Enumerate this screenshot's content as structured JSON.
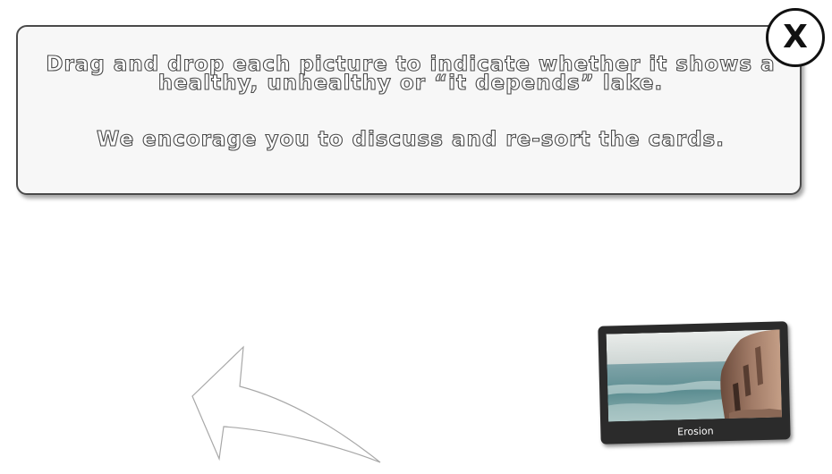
{
  "instructions": {
    "line1": "Drag and drop each picture to indicate whether it shows a healthy, unhealthy or “it depends” lake.",
    "line2": "We encorage you to discuss and re-sort the cards."
  },
  "close_button": {
    "label": "X"
  },
  "cards": [
    {
      "label": "Erosion",
      "image": "rocky-shoreline-photo"
    }
  ],
  "icons": {
    "close": "close-icon",
    "hint_arrow": "curved-arrow-icon"
  },
  "colors": {
    "outline": "#4a4a4a",
    "card_frame": "#2b2b2b",
    "box_fill": "#f7f7f7"
  }
}
